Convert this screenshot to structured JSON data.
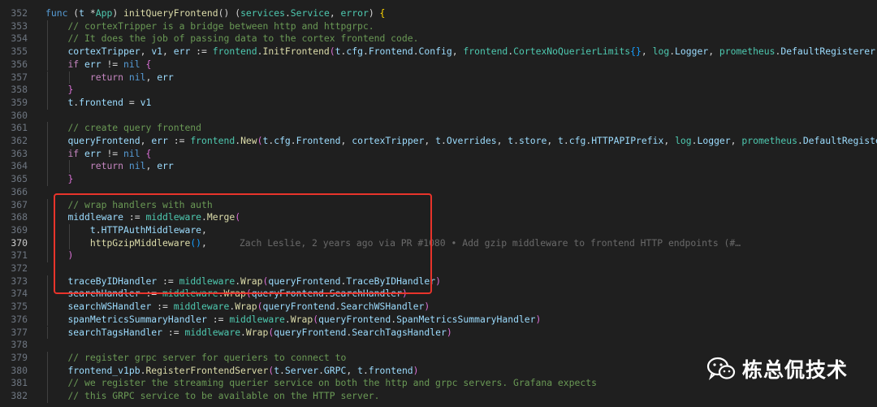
{
  "lines": [
    {
      "n": "352",
      "parts": [
        [
          "k",
          "func "
        ],
        [
          "o",
          "("
        ],
        [
          "v",
          "t "
        ],
        [
          "o",
          "*"
        ],
        [
          "t",
          "App"
        ],
        [
          "o",
          ") "
        ],
        [
          "f",
          "initQueryFrontend"
        ],
        [
          "o",
          "() ("
        ],
        [
          "t",
          "services"
        ],
        [
          "o",
          "."
        ],
        [
          "t",
          "Service"
        ],
        [
          "o",
          ", "
        ],
        [
          "t",
          "error"
        ],
        [
          "o",
          ") "
        ],
        [
          "p",
          "{"
        ]
      ]
    },
    {
      "n": "353",
      "parts": [
        [
          "c",
          "// cortexTripper is a bridge between http and httpgrpc."
        ]
      ]
    },
    {
      "n": "354",
      "parts": [
        [
          "c",
          "// It does the job of passing data to the cortex frontend code."
        ]
      ]
    },
    {
      "n": "355",
      "parts": [
        [
          "v",
          "cortexTripper"
        ],
        [
          "o",
          ", "
        ],
        [
          "v",
          "v1"
        ],
        [
          "o",
          ", "
        ],
        [
          "v",
          "err"
        ],
        [
          "o",
          " := "
        ],
        [
          "t",
          "frontend"
        ],
        [
          "o",
          "."
        ],
        [
          "f",
          "InitFrontend"
        ],
        [
          "p2",
          "("
        ],
        [
          "v",
          "t"
        ],
        [
          "o",
          "."
        ],
        [
          "v",
          "cfg"
        ],
        [
          "o",
          "."
        ],
        [
          "v",
          "Frontend"
        ],
        [
          "o",
          "."
        ],
        [
          "v",
          "Config"
        ],
        [
          "o",
          ", "
        ],
        [
          "t",
          "frontend"
        ],
        [
          "o",
          "."
        ],
        [
          "t",
          "CortexNoQuerierLimits"
        ],
        [
          "p3",
          "{}"
        ],
        [
          "o",
          ", "
        ],
        [
          "t",
          "log"
        ],
        [
          "o",
          "."
        ],
        [
          "v",
          "Logger"
        ],
        [
          "o",
          ", "
        ],
        [
          "t",
          "prometheus"
        ],
        [
          "o",
          "."
        ],
        [
          "v",
          "DefaultRegisterer"
        ],
        [
          "p2",
          ")"
        ]
      ]
    },
    {
      "n": "356",
      "parts": [
        [
          "kc",
          "if "
        ],
        [
          "v",
          "err"
        ],
        [
          "o",
          " != "
        ],
        [
          "k",
          "nil "
        ],
        [
          "p2",
          "{"
        ]
      ]
    },
    {
      "n": "357",
      "parts": [
        [
          "kc",
          "return "
        ],
        [
          "k",
          "nil"
        ],
        [
          "o",
          ", "
        ],
        [
          "v",
          "err"
        ]
      ]
    },
    {
      "n": "358",
      "parts": [
        [
          "p2",
          "}"
        ]
      ]
    },
    {
      "n": "359",
      "parts": [
        [
          "v",
          "t"
        ],
        [
          "o",
          "."
        ],
        [
          "v",
          "frontend"
        ],
        [
          "o",
          " = "
        ],
        [
          "v",
          "v1"
        ]
      ]
    },
    {
      "n": "360",
      "parts": []
    },
    {
      "n": "361",
      "parts": [
        [
          "c",
          "// create query frontend"
        ]
      ]
    },
    {
      "n": "362",
      "parts": [
        [
          "v",
          "queryFrontend"
        ],
        [
          "o",
          ", "
        ],
        [
          "v",
          "err"
        ],
        [
          "o",
          " := "
        ],
        [
          "t",
          "frontend"
        ],
        [
          "o",
          "."
        ],
        [
          "f",
          "New"
        ],
        [
          "p2",
          "("
        ],
        [
          "v",
          "t"
        ],
        [
          "o",
          "."
        ],
        [
          "v",
          "cfg"
        ],
        [
          "o",
          "."
        ],
        [
          "v",
          "Frontend"
        ],
        [
          "o",
          ", "
        ],
        [
          "v",
          "cortexTripper"
        ],
        [
          "o",
          ", "
        ],
        [
          "v",
          "t"
        ],
        [
          "o",
          "."
        ],
        [
          "v",
          "Overrides"
        ],
        [
          "o",
          ", "
        ],
        [
          "v",
          "t"
        ],
        [
          "o",
          "."
        ],
        [
          "v",
          "store"
        ],
        [
          "o",
          ", "
        ],
        [
          "v",
          "t"
        ],
        [
          "o",
          "."
        ],
        [
          "v",
          "cfg"
        ],
        [
          "o",
          "."
        ],
        [
          "v",
          "HTTPAPIPrefix"
        ],
        [
          "o",
          ", "
        ],
        [
          "t",
          "log"
        ],
        [
          "o",
          "."
        ],
        [
          "v",
          "Logger"
        ],
        [
          "o",
          ", "
        ],
        [
          "t",
          "prometheus"
        ],
        [
          "o",
          "."
        ],
        [
          "v",
          "DefaultRegisterer"
        ],
        [
          "p2",
          ")"
        ]
      ]
    },
    {
      "n": "363",
      "parts": [
        [
          "kc",
          "if "
        ],
        [
          "v",
          "err"
        ],
        [
          "o",
          " != "
        ],
        [
          "k",
          "nil "
        ],
        [
          "p2",
          "{"
        ]
      ]
    },
    {
      "n": "364",
      "parts": [
        [
          "kc",
          "return "
        ],
        [
          "k",
          "nil"
        ],
        [
          "o",
          ", "
        ],
        [
          "v",
          "err"
        ]
      ]
    },
    {
      "n": "365",
      "parts": [
        [
          "p2",
          "}"
        ]
      ]
    },
    {
      "n": "366",
      "parts": []
    },
    {
      "n": "367",
      "parts": [
        [
          "c",
          "// wrap handlers with auth"
        ]
      ]
    },
    {
      "n": "368",
      "parts": [
        [
          "v",
          "middleware"
        ],
        [
          "o",
          " := "
        ],
        [
          "t",
          "middleware"
        ],
        [
          "o",
          "."
        ],
        [
          "f",
          "Merge"
        ],
        [
          "p2",
          "("
        ]
      ]
    },
    {
      "n": "369",
      "parts": [
        [
          "v",
          "t"
        ],
        [
          "o",
          "."
        ],
        [
          "v",
          "HTTPAuthMiddleware"
        ],
        [
          "o",
          ","
        ]
      ]
    },
    {
      "n": "370",
      "parts": [
        [
          "f",
          "httpGzipMiddleware"
        ],
        [
          "p3",
          "()"
        ],
        [
          "o",
          ","
        ]
      ]
    },
    {
      "n": "371",
      "parts": [
        [
          "p2",
          ")"
        ]
      ]
    },
    {
      "n": "372",
      "parts": []
    },
    {
      "n": "373",
      "parts": [
        [
          "v",
          "traceByIDHandler"
        ],
        [
          "o",
          " := "
        ],
        [
          "t",
          "middleware"
        ],
        [
          "o",
          "."
        ],
        [
          "f",
          "Wrap"
        ],
        [
          "p2",
          "("
        ],
        [
          "v",
          "queryFrontend"
        ],
        [
          "o",
          "."
        ],
        [
          "v",
          "TraceByIDHandler"
        ],
        [
          "p2",
          ")"
        ]
      ]
    },
    {
      "n": "374",
      "parts": [
        [
          "v",
          "searchHandler"
        ],
        [
          "o",
          " := "
        ],
        [
          "t",
          "middleware"
        ],
        [
          "o",
          "."
        ],
        [
          "f",
          "Wrap"
        ],
        [
          "p2",
          "("
        ],
        [
          "v",
          "queryFrontend"
        ],
        [
          "o",
          "."
        ],
        [
          "v",
          "SearchHandler"
        ],
        [
          "p2",
          ")"
        ]
      ]
    },
    {
      "n": "375",
      "parts": [
        [
          "v",
          "searchWSHandler"
        ],
        [
          "o",
          " := "
        ],
        [
          "t",
          "middleware"
        ],
        [
          "o",
          "."
        ],
        [
          "f",
          "Wrap"
        ],
        [
          "p2",
          "("
        ],
        [
          "v",
          "queryFrontend"
        ],
        [
          "o",
          "."
        ],
        [
          "v",
          "SearchWSHandler"
        ],
        [
          "p2",
          ")"
        ]
      ]
    },
    {
      "n": "376",
      "parts": [
        [
          "v",
          "spanMetricsSummaryHandler"
        ],
        [
          "o",
          " := "
        ],
        [
          "t",
          "middleware"
        ],
        [
          "o",
          "."
        ],
        [
          "f",
          "Wrap"
        ],
        [
          "p2",
          "("
        ],
        [
          "v",
          "queryFrontend"
        ],
        [
          "o",
          "."
        ],
        [
          "v",
          "SpanMetricsSummaryHandler"
        ],
        [
          "p2",
          ")"
        ]
      ]
    },
    {
      "n": "377",
      "parts": [
        [
          "v",
          "searchTagsHandler"
        ],
        [
          "o",
          " := "
        ],
        [
          "t",
          "middleware"
        ],
        [
          "o",
          "."
        ],
        [
          "f",
          "Wrap"
        ],
        [
          "p2",
          "("
        ],
        [
          "v",
          "queryFrontend"
        ],
        [
          "o",
          "."
        ],
        [
          "v",
          "SearchTagsHandler"
        ],
        [
          "p2",
          ")"
        ]
      ]
    },
    {
      "n": "378",
      "parts": []
    },
    {
      "n": "379",
      "parts": [
        [
          "c",
          "// register grpc server for queriers to connect to"
        ]
      ]
    },
    {
      "n": "380",
      "parts": [
        [
          "v",
          "frontend_v1pb"
        ],
        [
          "o",
          "."
        ],
        [
          "f",
          "RegisterFrontendServer"
        ],
        [
          "p2",
          "("
        ],
        [
          "v",
          "t"
        ],
        [
          "o",
          "."
        ],
        [
          "v",
          "Server"
        ],
        [
          "o",
          "."
        ],
        [
          "v",
          "GRPC"
        ],
        [
          "o",
          ", "
        ],
        [
          "v",
          "t"
        ],
        [
          "o",
          "."
        ],
        [
          "v",
          "frontend"
        ],
        [
          "p2",
          ")"
        ]
      ]
    },
    {
      "n": "381",
      "parts": [
        [
          "c",
          "// we register the streaming querier service on both the http and grpc servers. Grafana expects"
        ]
      ]
    },
    {
      "n": "382",
      "parts": [
        [
          "c",
          "// this GRPC service to be available on the HTTP server."
        ]
      ]
    }
  ],
  "blame": "Zach Leslie, 2 years ago via PR #1080 • Add gzip middleware to frontend HTTP endpoints (#…",
  "watermark": "栋总侃技术",
  "colors": {
    "highlight_border": "#e8342b",
    "background": "#1f1f1f"
  }
}
